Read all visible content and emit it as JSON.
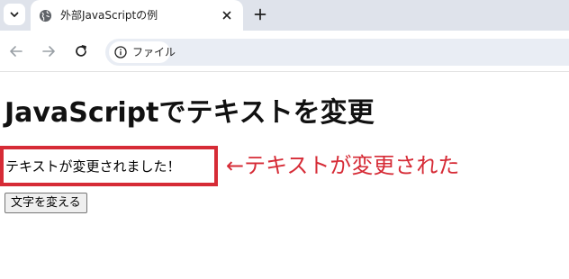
{
  "browser": {
    "tab": {
      "title": "外部JavaScriptの例"
    },
    "omnibox": {
      "chip_label": "ファイル"
    },
    "icons": {
      "tab_list": "chevron-down-icon",
      "favicon": "globe-icon",
      "close": "close-icon",
      "new_tab": "plus-icon",
      "back": "arrow-left-icon",
      "forward": "arrow-right-icon",
      "reload": "reload-icon",
      "info": "info-icon"
    }
  },
  "page": {
    "heading": "JavaScriptでテキストを変更",
    "paragraph": "テキストが変更されました！",
    "button_label": "文字を変える"
  },
  "annotation": {
    "text": "←テキストが変更された",
    "color": "#d62b36"
  }
}
